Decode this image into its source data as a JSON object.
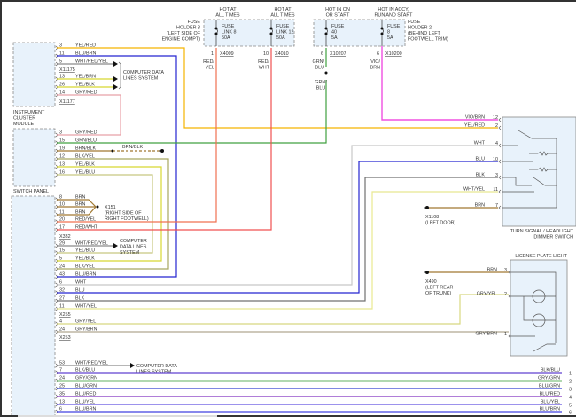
{
  "fuse_holder_3": {
    "label": [
      "FUSE",
      "HOLDER 3",
      "(LEFT SIDE OF",
      "ENGINE COMPT)"
    ],
    "fuses": [
      {
        "hot": [
          "HOT AT",
          "ALL TIMES"
        ],
        "name": [
          "FUSE",
          "LINK 8",
          "50A"
        ],
        "pin": "1",
        "connector": "X4009",
        "wire": [
          "RED/",
          "YEL"
        ]
      },
      {
        "hot": [
          "HOT AT",
          "ALL TIMES"
        ],
        "name": [
          "FUSE",
          "LINK 12",
          "50A"
        ],
        "pin": "10",
        "connector": "X4010",
        "wire": [
          "RED/",
          "WHT"
        ]
      }
    ]
  },
  "fuse_holder_2": {
    "label": [
      "FUSE",
      "HOLDER 2",
      "(BEHIND LEFT",
      "FOOTWELL TRIM)"
    ],
    "fuses": [
      {
        "hot": [
          "HOT IN ON",
          "OR START"
        ],
        "name": [
          "FUSE",
          "40",
          "5A"
        ],
        "pin": "6",
        "connector": "X10207",
        "wire": [
          "GRN/",
          "BLU"
        ],
        "wire_below": [
          "GRN/",
          "BLU"
        ]
      },
      {
        "hot": [
          "HOT IN ACCY,",
          "RUN AND START"
        ],
        "name": [
          "FUSE",
          "8",
          "5A"
        ],
        "pin": "6",
        "connector": "X10200",
        "wire": [
          "VIO/",
          "BRN"
        ]
      }
    ]
  },
  "instrument_cluster": {
    "label": [
      "INSTRUMENT",
      "CLUSTER",
      "MODULE"
    ],
    "pins": [
      {
        "pin": "3",
        "wire": "YEL/RED"
      },
      {
        "pin": "11",
        "wire": "BLU/BRN"
      },
      {
        "pin": "5",
        "wire": "WHT/RED/YEL"
      },
      {
        "pin": "13",
        "wire": "YEL/BRN"
      },
      {
        "pin": "26",
        "wire": "YEL/BLK"
      },
      {
        "pin": "14",
        "wire": "GRY/RED"
      }
    ],
    "connectors": [
      "X11175",
      "X11177"
    ],
    "data_lines": [
      "COMPUTER DATA",
      "LINES SYSTEM"
    ]
  },
  "switch_panel": {
    "label": "SWITCH PANEL",
    "pins_upper": [
      {
        "pin": "3",
        "wire": "GRY/RED"
      },
      {
        "pin": "15",
        "wire": "GRN/BLU"
      },
      {
        "pin": "19",
        "wire": "BRN/BLK"
      },
      {
        "pin": "12",
        "wire": "BLK/YEL"
      },
      {
        "pin": "13",
        "wire": "YEL/BLK"
      },
      {
        "pin": "16",
        "wire": "YEL/BLU"
      }
    ],
    "pins_lower": [
      {
        "pin": "8",
        "wire": "BRN"
      },
      {
        "pin": "10",
        "wire": "BRN"
      },
      {
        "pin": "11",
        "wire": "BRN"
      },
      {
        "pin": "20",
        "wire": "RED/YEL"
      },
      {
        "pin": "17",
        "wire": "RED/WHT"
      },
      {
        "pin": "29",
        "wire": "WHT/RED/YEL"
      },
      {
        "pin": "15",
        "wire": "YEL/BLU"
      },
      {
        "pin": "5",
        "wire": "YEL/BLK"
      },
      {
        "pin": "24",
        "wire": "BLK/YEL"
      },
      {
        "pin": "43",
        "wire": "BLU/BRN"
      },
      {
        "pin": "6",
        "wire": "WHT"
      },
      {
        "pin": "32",
        "wire": "BLU"
      },
      {
        "pin": "27",
        "wire": "BLK"
      },
      {
        "pin": "11",
        "wire": "WHT/YEL"
      },
      {
        "pin": "4",
        "wire": "GRY/YEL"
      },
      {
        "pin": "24",
        "wire": "GRY/BRN"
      },
      {
        "pin": "53",
        "wire": "WHT/RED/YEL"
      },
      {
        "pin": "7",
        "wire": "BLK/BLU"
      },
      {
        "pin": "24",
        "wire": "GRY/GRN"
      },
      {
        "pin": "25",
        "wire": "BLU/GRN"
      },
      {
        "pin": "35",
        "wire": "BLU/RED"
      },
      {
        "pin": "13",
        "wire": "BLU/YEL"
      },
      {
        "pin": "6",
        "wire": "BLU/BRN"
      }
    ],
    "connectors": [
      "X332",
      "X255",
      "X253"
    ],
    "brn_blk_label": "BRN/BLK",
    "splice": {
      "name": "X151",
      "location": [
        "(RIGHT SIDE OF",
        "RIGHT FOOTWELL)"
      ]
    },
    "data_lines_a": [
      "COMPUTER",
      "DATA LINES",
      "SYSTEM"
    ],
    "data_lines_b": [
      "COMPUTER DATA",
      "LINES SYSTEM"
    ]
  },
  "turn_signal_switch": {
    "label": [
      "TURN SIGNAL / HEADLIGHT",
      "DIMMER SWITCH"
    ],
    "pins": [
      {
        "pin": "12",
        "wire": "VIO/BRN"
      },
      {
        "pin": "2",
        "wire": "YEL/RED"
      },
      {
        "pin": "4",
        "wire": "WHT"
      },
      {
        "pin": "10",
        "wire": "BLU"
      },
      {
        "pin": "3",
        "wire": "BLK"
      },
      {
        "pin": "11",
        "wire": "WHT/YEL"
      },
      {
        "pin": "7",
        "wire": "BRN"
      }
    ],
    "ground": {
      "name": "X1108",
      "location": "(LEFT DOOR)"
    }
  },
  "license_plate_light": {
    "label": "LICENSE PLATE LIGHT",
    "pins": [
      {
        "pin": "3",
        "wire": "BRN"
      },
      {
        "pin": "2",
        "wire": "GRY/YEL"
      },
      {
        "pin": "1",
        "wire": "GRY/BRN"
      }
    ],
    "ground": {
      "name": "X490",
      "location": [
        "(LEFT REAR",
        "OF TRUNK)"
      ]
    }
  },
  "right_edge": [
    {
      "wire": "BLK/BLU",
      "num": "1"
    },
    {
      "wire": "GRY/GRN",
      "num": "2"
    },
    {
      "wire": "BLU/GRN",
      "num": "3"
    },
    {
      "wire": "BLU/RED",
      "num": "4"
    },
    {
      "wire": "BLU/YEL",
      "num": "5"
    },
    {
      "wire": "BLU/BRN",
      "num": "6"
    }
  ],
  "wire_colors": {
    "yel_red": "#f5b400",
    "blu": "#2424d0",
    "gry": "#8a8a8a",
    "yel": "#d8d830",
    "gry_red": "#e8a0a8",
    "grn": "#40a040",
    "brn": "#a07830",
    "blk_yel": "#a8a860",
    "yel_blu": "#c8c880",
    "red_yel": "#f07050",
    "red_wht": "#f05050",
    "wht": "#c8c8c8",
    "blk": "#707070",
    "wht_yel": "#e8e890",
    "gry_yel": "#d8d880",
    "gry_brn": "#b0a890",
    "vio_brn": "#f050e0",
    "blk_blu": "#6040d0",
    "gry_grn": "#80c080",
    "blu_grn": "#3040d0",
    "blu_red": "#8030c0",
    "blu_yel": "#6050e0",
    "blu_brn": "#4040e0"
  }
}
